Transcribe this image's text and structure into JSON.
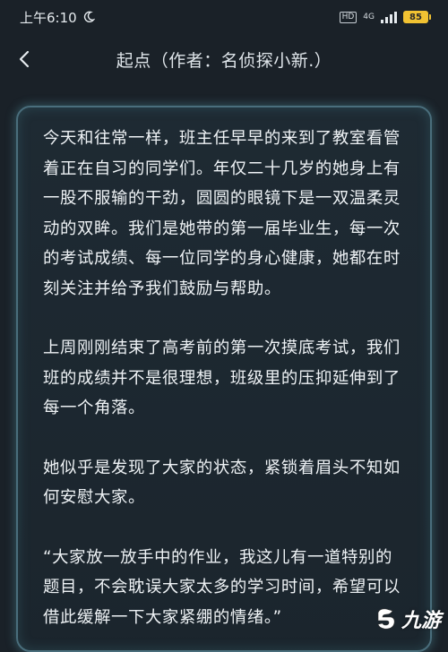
{
  "status_bar": {
    "time": "上午6:10",
    "hd": "HD",
    "network": "4G",
    "battery": "85"
  },
  "nav": {
    "title": "起点（作者：名侦探小新.）"
  },
  "content": {
    "paragraphs": [
      "今天和往常一样，班主任早早的来到了教室看管着正在自习的同学们。年仅二十几岁的她身上有一股不服输的干劲，圆圆的眼镜下是一双温柔灵动的双眸。我们是她带的第一届毕业生，每一次的考试成绩、每一位同学的身心健康，她都在时刻关注并给予我们鼓励与帮助。",
      "上周刚刚结束了高考前的第一次摸底考试，我们班的成绩并不是很理想，班级里的压抑延伸到了每一个角落。",
      "她似乎是发现了大家的状态，紧锁着眉头不知如何安慰大家。",
      "“大家放一放手中的作业，我这儿有一道特别的题目，不会耽误大家太多的学习时间，希望可以借此缓解一下大家紧绷的情绪。”"
    ]
  },
  "watermark": {
    "text": "九游"
  },
  "colors": {
    "background": "#1a2128",
    "card_border": "#4a6e7c",
    "battery": "#f1c232"
  }
}
